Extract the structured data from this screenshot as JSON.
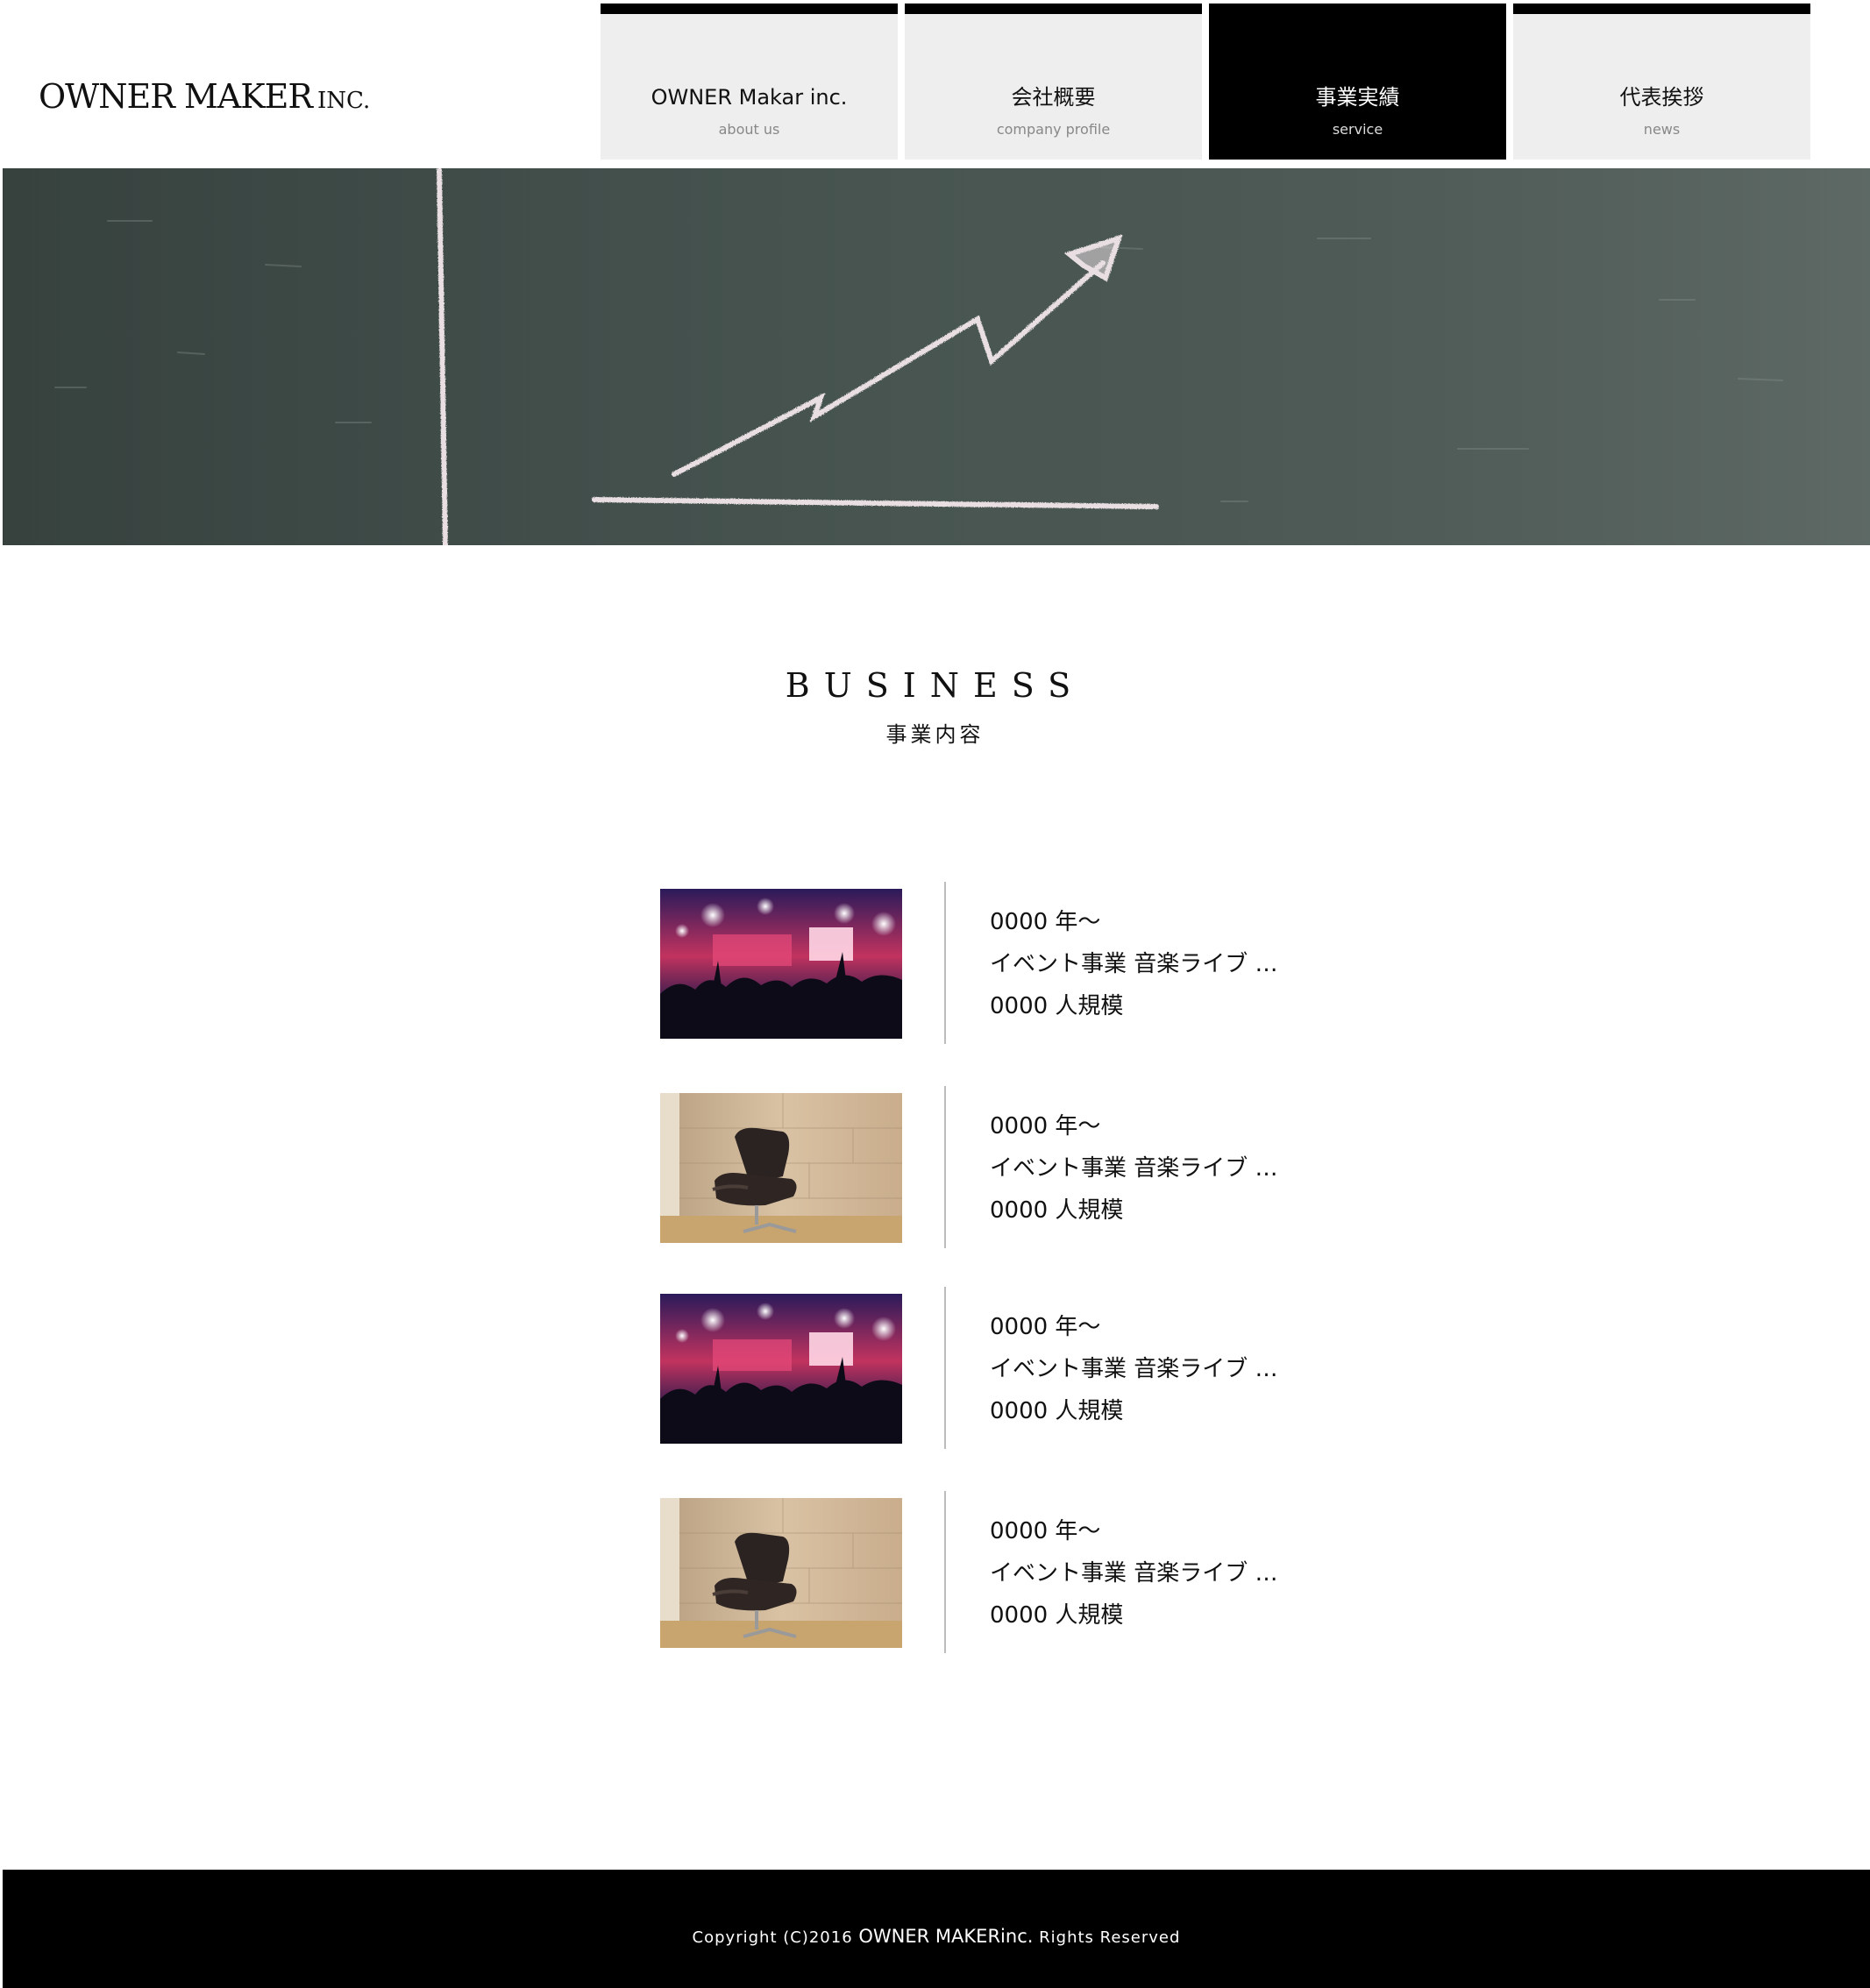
{
  "header": {
    "logo_main": "OWNER MAKER",
    "logo_suffix": "INC."
  },
  "nav": {
    "items": [
      {
        "title": "OWNER Makar inc.",
        "sub": "about us",
        "active": false
      },
      {
        "title": "会社概要",
        "sub": "company profile",
        "active": false
      },
      {
        "title": "事業実績",
        "sub": "service",
        "active": true
      },
      {
        "title": "代表挨拶",
        "sub": "news",
        "active": false
      }
    ]
  },
  "hero": {
    "image": "chalkboard-growth-chart"
  },
  "section": {
    "title": "BUSINESS",
    "subtitle": "事業内容"
  },
  "business": {
    "items": [
      {
        "image": "concert-crowd",
        "year": "0000 年〜",
        "desc": "イベント事業 音楽ライブ …",
        "scale": "0000 人規模"
      },
      {
        "image": "lounge-chair",
        "year": "0000 年〜",
        "desc": "イベント事業 音楽ライブ …",
        "scale": "0000 人規模"
      },
      {
        "image": "concert-crowd",
        "year": "0000 年〜",
        "desc": "イベント事業 音楽ライブ …",
        "scale": "0000 人規模"
      },
      {
        "image": "lounge-chair",
        "year": "0000 年〜",
        "desc": "イベント事業 音楽ライブ …",
        "scale": "0000 人規模"
      }
    ]
  },
  "footer": {
    "copyright_prefix": "Copyright (C)2016",
    "copyright_brand": "OWNER MAKERinc.",
    "copyright_suffix": "Rights Reserved"
  },
  "colors": {
    "nav_bg": "#eeeeee",
    "nav_active_bg": "#000000",
    "chalkboard": "#46534f",
    "footer_bg": "#000000"
  }
}
